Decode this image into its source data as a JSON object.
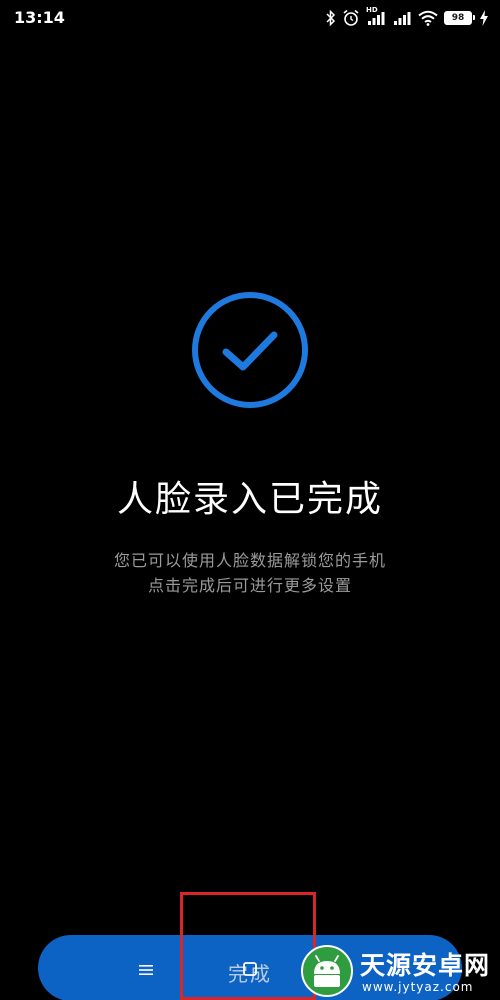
{
  "status_bar": {
    "time": "13:14",
    "icons": [
      "bluetooth-icon",
      "alarm-icon",
      "hd-signal-icon",
      "signal-icon",
      "wifi-icon",
      "battery-icon",
      "charging-icon"
    ],
    "hd_label": "HD",
    "battery_level": "98",
    "battery_color": "#4cd964"
  },
  "main": {
    "success_icon": "check-circle-icon",
    "accent_color": "#1f7ae0",
    "title": "人脸录入已完成",
    "description_line1": "您已可以使用人脸数据解锁您的手机",
    "description_line2": "点击完成后可进行更多设置"
  },
  "footer": {
    "done_label": "完成",
    "done_button_color": "#0d63c4",
    "nav_icons": [
      "menu-icon",
      "home-icon"
    ],
    "highlight_color": "#d9262b"
  },
  "watermark": {
    "title": "天源安卓网",
    "url": "www.jytyaz.com"
  }
}
